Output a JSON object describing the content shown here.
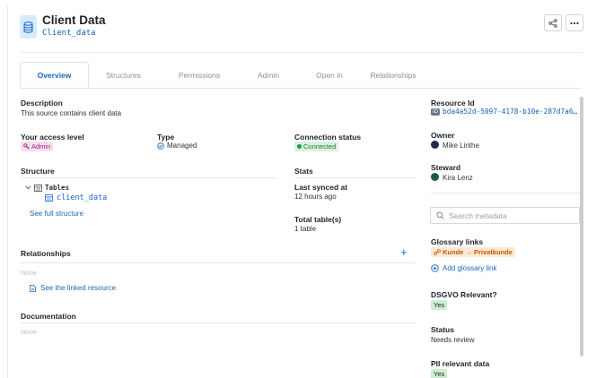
{
  "header": {
    "title": "Client Data",
    "subtitle": "Client_data",
    "database_icon": "database-icon",
    "share_icon": "share-icon",
    "more_icon": "more-icon"
  },
  "tabs": [
    {
      "label": "Overview",
      "active": true
    },
    {
      "label": "Structures",
      "active": false
    },
    {
      "label": "Permissions",
      "active": false
    },
    {
      "label": "Admin",
      "active": false
    },
    {
      "label": "Open in",
      "active": false
    },
    {
      "label": "Relationships",
      "active": false
    }
  ],
  "description": {
    "label": "Description",
    "text": "This source contains client data"
  },
  "access": {
    "label": "Your access level",
    "value": "Admin"
  },
  "type": {
    "label": "Type",
    "value": "Managed"
  },
  "connection": {
    "label": "Connection status",
    "value": "Connected"
  },
  "structure": {
    "label": "Structure",
    "folder": "Tables",
    "table": "client_data",
    "link": "See full structure"
  },
  "stats": {
    "label": "Stats",
    "last_synced_label": "Last synced at",
    "last_synced_value": "12 hours ago",
    "total_tables_label": "Total table(s)",
    "total_tables_value": "1 table"
  },
  "relationships": {
    "label": "Relationships",
    "empty": "None",
    "link": "See the linked resource",
    "add": "+"
  },
  "documentation": {
    "label": "Documentation",
    "empty": "None"
  },
  "sidebar": {
    "resource_id_label": "Resource Id",
    "resource_id_prefix": "ID",
    "resource_id_value": "bda4a52d-5097-4178-b10e-287d7a6…",
    "owner_label": "Owner",
    "owner_value": "Mike Linthe",
    "steward_label": "Steward",
    "steward_value": "Kira Lenz",
    "search_placeholder": "Search metadata",
    "glossary_label": "Glossary links",
    "glossary_value": "Kunde → Privatkunde",
    "glossary_add": "Add glossary link",
    "dsgvo_label": "DSGVO Relevant?",
    "dsgvo_value": "Yes",
    "status_label": "Status",
    "status_value": "Needs review",
    "pii_label": "PII relevant data",
    "pii_value": "Yes"
  },
  "colors": {
    "accent": "#1a66c2",
    "connected_bg": "#d9f2dd",
    "connected_fg": "#1e7a34",
    "admin_bg": "#f7dff0",
    "admin_fg": "#9b2a7e",
    "glossary_bg": "#fde9d6",
    "glossary_fg": "#c25a0c",
    "yes_bg": "#cdeed3"
  }
}
